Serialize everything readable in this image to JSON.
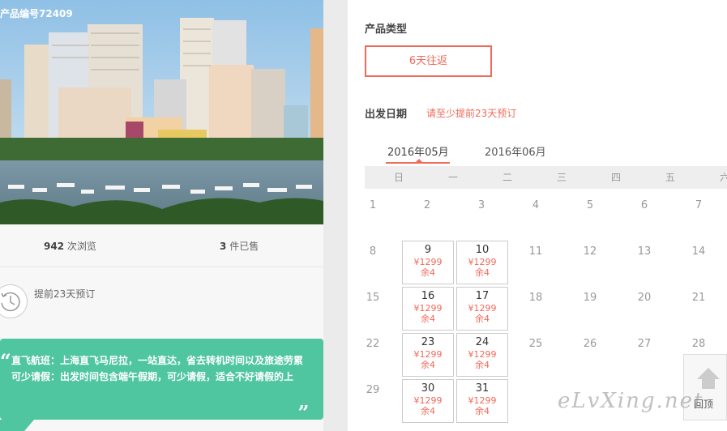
{
  "left": {
    "product_code": "产品编号72409",
    "views_count": "942",
    "views_label": "次浏览",
    "sold_count": "3",
    "sold_label": "件已售",
    "advance_text": "提前23天预订",
    "promo_lines": [
      "直飞航班：上海直飞马尼拉，一站直达，省去转机时间以及旅途劳累",
      "可少请假：出发时间包含端午假期，可少请假，适合不好请假的上"
    ],
    "quote_open": "“",
    "quote_close": "„"
  },
  "right": {
    "type_title": "产品类型",
    "type_option": "6天往返",
    "date_title": "出发日期",
    "date_note": "请至少提前23天预订",
    "months": [
      "2016年05月",
      "2016年06月"
    ],
    "weekdays": [
      "日",
      "一",
      "二",
      "三",
      "四",
      "五",
      "六"
    ],
    "rows": [
      [
        "1",
        "2",
        "3",
        "4",
        "5",
        "6",
        "7"
      ],
      [
        "8",
        "9",
        "10",
        "11",
        "12",
        "13",
        "14"
      ],
      [
        "15",
        "16",
        "17",
        "18",
        "19",
        "20",
        "21"
      ],
      [
        "22",
        "23",
        "24",
        "25",
        "26",
        "27",
        "28"
      ],
      [
        "29",
        "30",
        "31"
      ]
    ],
    "bookable": {
      "9": {
        "price": "¥1299",
        "left": "余4"
      },
      "10": {
        "price": "¥1299",
        "left": "余4"
      },
      "16": {
        "price": "¥1299",
        "left": "余4"
      },
      "17": {
        "price": "¥1299",
        "left": "余4"
      },
      "23": {
        "price": "¥1299",
        "left": "余4"
      },
      "24": {
        "price": "¥1299",
        "left": "余4"
      },
      "30": {
        "price": "¥1299",
        "left": "余4"
      },
      "31": {
        "price": "¥1299",
        "left": "余4"
      }
    }
  },
  "back_top_label": "回顶",
  "watermark": "eLvXing.net",
  "colors": {
    "accent": "#f06a5a",
    "promo": "#4fc5a0"
  }
}
